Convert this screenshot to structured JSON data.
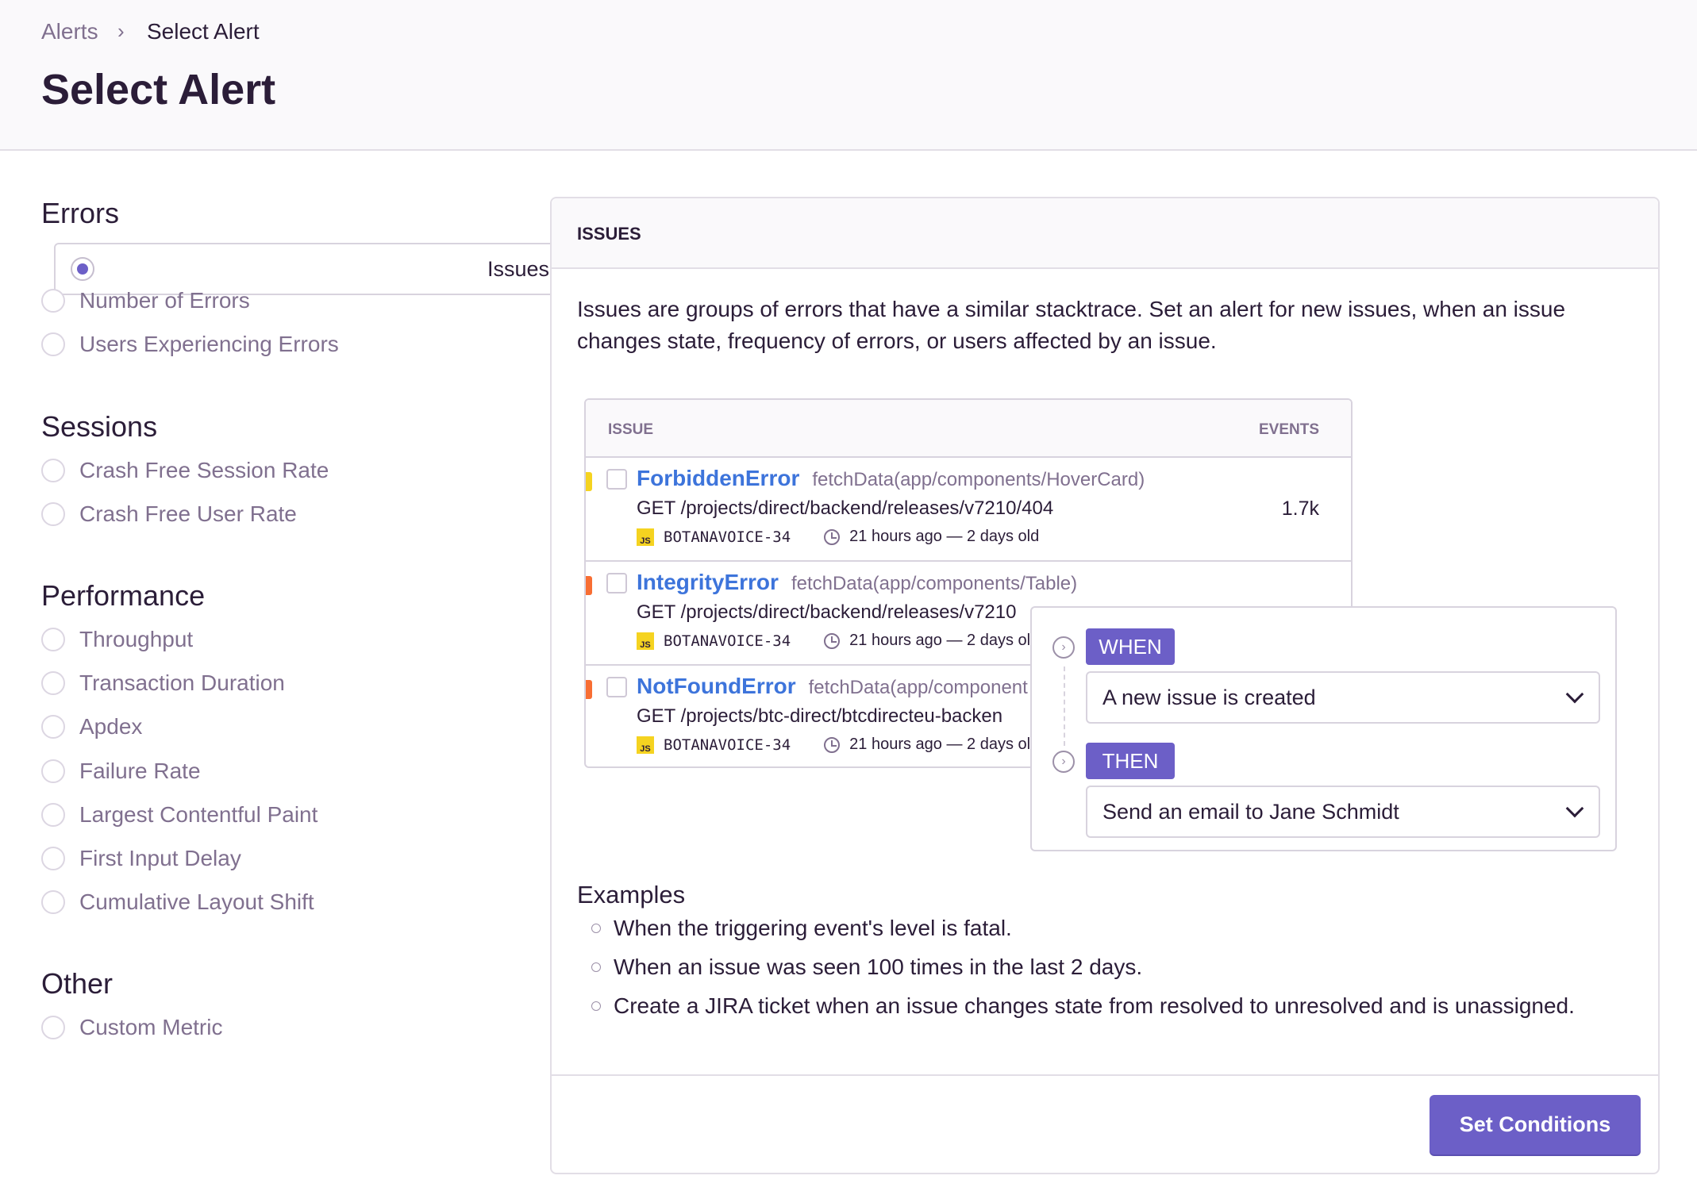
{
  "breadcrumb": {
    "parent": "Alerts",
    "current": "Select Alert"
  },
  "title": "Select Alert",
  "sidebar": {
    "groups": [
      {
        "label": "Errors",
        "items": [
          "Issues",
          "Number of Errors",
          "Users Experiencing Errors"
        ]
      },
      {
        "label": "Sessions",
        "items": [
          "Crash Free Session Rate",
          "Crash Free User Rate"
        ]
      },
      {
        "label": "Performance",
        "items": [
          "Throughput",
          "Transaction Duration",
          "Apdex",
          "Failure Rate",
          "Largest Contentful Paint",
          "First Input Delay",
          "Cumulative Layout Shift"
        ]
      },
      {
        "label": "Other",
        "items": [
          "Custom Metric"
        ]
      }
    ],
    "selected": "Issues"
  },
  "panel": {
    "header": "ISSUES",
    "description": "Issues are groups of errors that have a similar stacktrace. Set an alert for new issues, when an issue changes state, frequency of errors, or users affected by an issue.",
    "table": {
      "columns": [
        "ISSUE",
        "EVENTS"
      ],
      "rows": [
        {
          "title": "ForbiddenError",
          "culprit": "fetchData(app/components/HoverCard)",
          "request": "GET /projects/direct/backend/releases/v7210/404",
          "platform": "JS",
          "short_id": "BOTANAVOICE-34",
          "time": "21 hours ago — 2 days old",
          "events": "1.7k",
          "level_color": "#f5d320"
        },
        {
          "title": "IntegrityError",
          "culprit": "fetchData(app/components/Table)",
          "request": "GET /projects/direct/backend/releases/v7210",
          "platform": "JS",
          "short_id": "BOTANAVOICE-34",
          "time": "21 hours ago — 2 days ol",
          "level_color": "#f86e33"
        },
        {
          "title": "NotFoundError",
          "culprit": "fetchData(app/component",
          "request": "GET /projects/btc-direct/btcdirecteu-backen",
          "platform": "JS",
          "short_id": "BOTANAVOICE-34",
          "time": "21 hours ago — 2 days ol",
          "level_color": "#f86e33"
        }
      ]
    },
    "rule": {
      "when_label": "WHEN",
      "when_value": "A new issue is created",
      "then_label": "THEN",
      "then_value": "Send an email to Jane Schmidt"
    },
    "examples_title": "Examples",
    "examples": [
      "When the triggering event's level is fatal.",
      "When an issue was seen 100 times in the last 2 days.",
      "Create a JIRA ticket when an issue changes state from resolved to unresolved and is unassigned."
    ],
    "button": "Set Conditions"
  },
  "colors": {
    "accent": "#6c5fc7",
    "link": "#3d74db"
  }
}
